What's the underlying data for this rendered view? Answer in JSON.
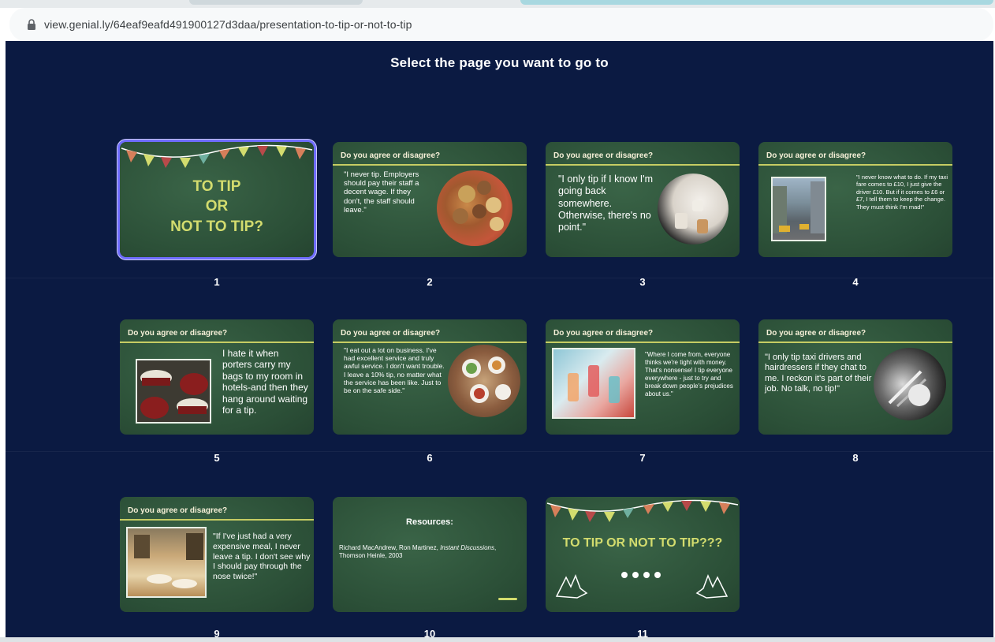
{
  "browser": {
    "url": "view.genial.ly/64eaf9eafd491900127d3daa/presentation-to-tip-or-not-to-tip"
  },
  "page": {
    "heading": "Select the page you want to go to"
  },
  "slides": [
    {
      "number": "1",
      "title_lines": [
        "TO TIP",
        "OR",
        "NOT TO TIP?"
      ]
    },
    {
      "number": "2",
      "header": "Do you agree or disagree?",
      "quote": "\"I never tip. Employers should pay their staff a decent wage. If they don't, the staff should leave.\""
    },
    {
      "number": "3",
      "header": "Do you agree or disagree?",
      "quote": "\"I only tip if I know I'm going back somewhere. Otherwise, there's no point.\""
    },
    {
      "number": "4",
      "header": "Do you agree or disagree?",
      "quote": "\"I never know what to do. If my taxi fare comes to £10, I just give the driver £10. But if it comes to £6 or £7, I tell them to keep the change. They must think I'm mad!\""
    },
    {
      "number": "5",
      "header": "Do you agree or disagree?",
      "quote": "I hate it when porters carry my bags to my room in hotels-and then they hang around waiting for a tip."
    },
    {
      "number": "6",
      "header": "Do you agree or disagree?",
      "quote": "\"I eat out a lot on business. I've had excellent service and truly awful service. I don't want trouble. I leave a 10% tip, no matter what the service has been like. Just to be on the safe side.\""
    },
    {
      "number": "7",
      "header": "Do you agree or disagree?",
      "quote": "\"Where I come from, everyone thinks we're tight with money. That's nonsense! I tip everyone everywhere - just to try and break down people's prejudices about us.\""
    },
    {
      "number": "8",
      "header": "Do you agree or disagree?",
      "quote": "\"I only tip taxi drivers and hairdressers if they chat to me. I reckon it's part of their job. No talk, no tip!\""
    },
    {
      "number": "9",
      "header": "Do you agree or disagree?",
      "quote": "\"If I've just had a very expensive meal, I never leave a tip. I don't see why I should pay through the nose twice!\""
    },
    {
      "number": "10",
      "resources_title": "Resources:",
      "resources_authors": "Richard MacAndrew, Ron Martinez, ",
      "resources_book": "Instant Discussions",
      "resources_publisher": ", Thomson Heinle, 2003"
    },
    {
      "number": "11",
      "title": "TO TIP OR NOT TO TIP???"
    }
  ],
  "colors": {
    "background": "#0b1a42",
    "slide_green": "#2f5a3d",
    "accent_yellow": "#d3dc6e",
    "selected_border": "#6f6cff"
  }
}
